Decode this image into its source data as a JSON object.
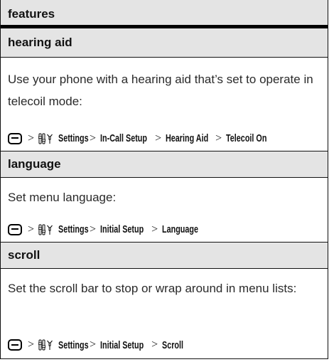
{
  "header": {
    "title": "features"
  },
  "sections": [
    {
      "title": "hearing aid",
      "description": "Use your phone with a hearing aid that’s set to operate in telecoil mode:",
      "path": {
        "separator": ">",
        "items": [
          "Settings",
          "In-Call Setup",
          "Hearing Aid",
          "Telecoil On"
        ]
      }
    },
    {
      "title": "language",
      "description": "Set menu language:",
      "path": {
        "separator": ">",
        "items": [
          "Settings",
          "Initial Setup",
          "Language"
        ]
      }
    },
    {
      "title": "scroll",
      "description": "Set the scroll bar to stop or wrap around in menu lists:",
      "path": {
        "separator": ">",
        "items": [
          "Settings",
          "Initial Setup",
          "Scroll"
        ]
      }
    }
  ],
  "icons": {
    "menu_key": "menu-key-icon",
    "settings": "settings-icon"
  }
}
